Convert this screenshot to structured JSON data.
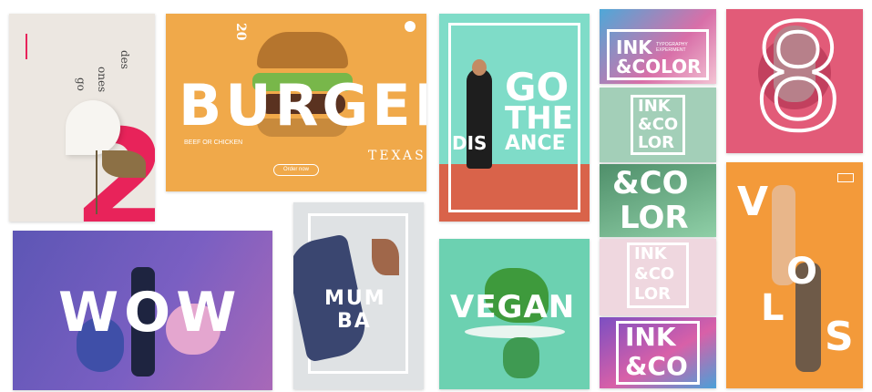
{
  "posters": {
    "flower": {
      "text_a": "go",
      "text_b": "ones",
      "text_c": "des",
      "number": "2"
    },
    "burger": {
      "title": "BURGER",
      "sub": "BEEF OR CHICKEN",
      "num": "20",
      "city": "TEXAS",
      "button": "Order now"
    },
    "distance": {
      "line1": "GO",
      "line2": "THE",
      "line3": "DIS",
      "line4": "ANCE"
    },
    "ink1": {
      "title_a": "INK",
      "title_b": "&COLOR",
      "tag": "TYPOGRAPHY EXPERIMENT"
    },
    "ink2": {
      "l1": "INK",
      "l2": "&CO",
      "l3": "LOR"
    },
    "ink3": {
      "l1": "&CO",
      "l2": "LOR"
    },
    "ink4": {
      "l1": "INK",
      "l2": "&CO",
      "l3": "LOR"
    },
    "ink5": {
      "l1": "INK",
      "l2": "&CO"
    },
    "portrait": {
      "number": "8"
    },
    "wow": {
      "title": "WOW"
    },
    "mumbai": {
      "l1": "MUM",
      "l2": "BA"
    },
    "vegan": {
      "title": "VEGAN"
    },
    "volley": {
      "letters": [
        "V",
        "O",
        "L",
        "S"
      ]
    }
  },
  "colors": {
    "burger_bg": "#f0a94a",
    "distance_bg": "#7fdcc8",
    "track": "#d9634a",
    "vegan_bg": "#6cd1b1",
    "orange": "#f39a3a",
    "portrait_bg": "#e25b78",
    "wow_bg": "#6a5bb8",
    "flower_red": "#e8235a"
  }
}
